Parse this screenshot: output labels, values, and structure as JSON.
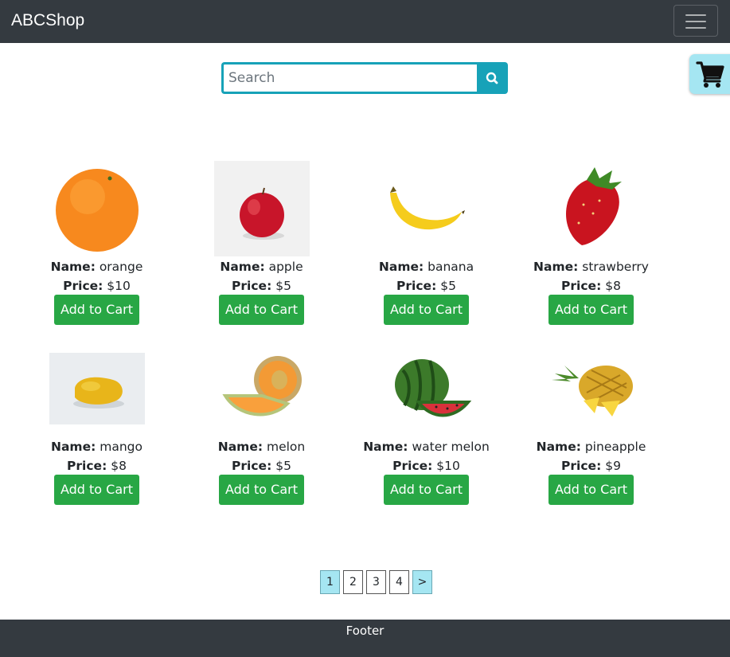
{
  "header": {
    "brand": "ABCShop"
  },
  "search": {
    "placeholder": "Search"
  },
  "labels": {
    "name": "Name:",
    "price": "Price:",
    "add_to_cart": "Add to Cart"
  },
  "products": [
    {
      "name": "orange",
      "price": "$10",
      "image": "orange"
    },
    {
      "name": "apple",
      "price": "$5",
      "image": "apple"
    },
    {
      "name": "banana",
      "price": "$5",
      "image": "banana"
    },
    {
      "name": "strawberry",
      "price": "$8",
      "image": "strawberry"
    },
    {
      "name": "mango",
      "price": "$8",
      "image": "mango"
    },
    {
      "name": "melon",
      "price": "$5",
      "image": "melon"
    },
    {
      "name": "water melon",
      "price": "$10",
      "image": "watermelon"
    },
    {
      "name": "pineapple",
      "price": "$9",
      "image": "pineapple"
    }
  ],
  "pagination": {
    "pages": [
      "1",
      "2",
      "3",
      "4"
    ],
    "current": "1",
    "next": ">"
  },
  "footer": {
    "text": "Footer"
  },
  "colors": {
    "navbar": "#343a40",
    "accent": "#17a2b8",
    "add_button": "#28a745",
    "cart_button": "#a5e6f2"
  }
}
